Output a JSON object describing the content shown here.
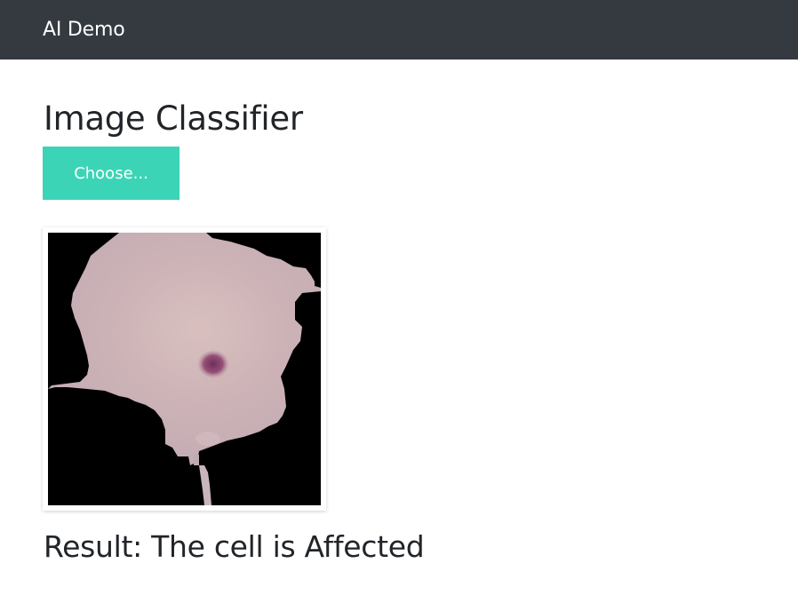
{
  "navbar": {
    "brand": "AI Demo"
  },
  "main": {
    "title": "Image Classifier",
    "choose_label": "Choose...",
    "result_text": "Result: The cell is Affected"
  },
  "colors": {
    "navbar_bg": "#343a40",
    "button_bg": "#3cd4b6",
    "cell_fill": "#c9b2b6",
    "stain": "#8e4a78"
  },
  "icons": {
    "preview": "cell-image-preview"
  }
}
